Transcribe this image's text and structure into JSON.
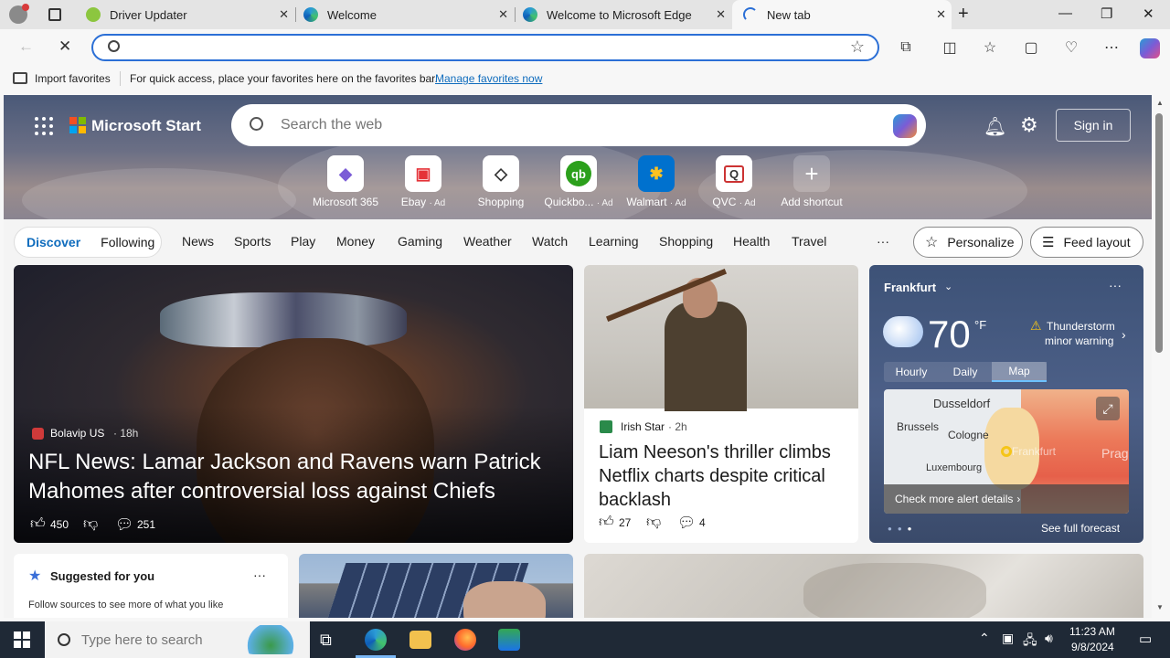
{
  "tabs": [
    {
      "title": "Driver Updater",
      "active": false
    },
    {
      "title": "Welcome",
      "active": false
    },
    {
      "title": "Welcome to Microsoft Edge",
      "active": false
    },
    {
      "title": "New tab",
      "active": true
    }
  ],
  "address": {
    "value": "",
    "placeholder": ""
  },
  "favbar": {
    "import_label": "Import favorites",
    "hint": "For quick access, place your favorites here on the favorites bar.",
    "manage_link": "Manage favorites now"
  },
  "header": {
    "brand": "Microsoft Start",
    "search_placeholder": "Search the web",
    "signin": "Sign in"
  },
  "shortcuts": [
    {
      "label": "Microsoft 365",
      "ad": "",
      "icon": "m365-icon",
      "glyph": "◆",
      "color": "#7b5cd6"
    },
    {
      "label": "Ebay",
      "ad": "· Ad",
      "icon": "ebay-icon",
      "glyph": "▣",
      "color": "#e53238"
    },
    {
      "label": "Shopping",
      "ad": "",
      "icon": "tag-icon",
      "glyph": "◇",
      "color": "#333333"
    },
    {
      "label": "Quickbo...",
      "ad": "· Ad",
      "icon": "quickbooks-icon",
      "glyph": "qb",
      "color": "#2ca01c"
    },
    {
      "label": "Walmart",
      "ad": "· Ad",
      "icon": "walmart-icon",
      "glyph": "✱",
      "color": "#0071ce"
    },
    {
      "label": "QVC",
      "ad": "· Ad",
      "icon": "qvc-icon",
      "glyph": "Q",
      "color": "#333333"
    },
    {
      "label": "Add shortcut",
      "ad": "",
      "icon": "plus-icon",
      "glyph": "+",
      "color": "#ffffff"
    }
  ],
  "feed_tabs": {
    "discover": "Discover",
    "following": "Following"
  },
  "nav": [
    "News",
    "Sports",
    "Play",
    "Money",
    "Gaming",
    "Weather",
    "Watch",
    "Learning",
    "Shopping",
    "Health",
    "Travel"
  ],
  "more": "···",
  "personalize": "Personalize",
  "feed_layout": "Feed layout",
  "big_story": {
    "source": "Bolavip US",
    "age": "· 18h",
    "headline": "NFL News: Lamar Jackson and Ravens warn Patrick Mahomes after controversial loss against Chiefs",
    "likes": "450",
    "comments": "251"
  },
  "mid_story": {
    "source": "Irish Star",
    "age": "· 2h",
    "headline": "Liam Neeson's thriller climbs Netflix charts despite critical backlash",
    "likes": "27",
    "comments": "4"
  },
  "weather": {
    "city": "Frankfurt",
    "temp": "70",
    "unit": "°F",
    "alert_line1": "Thunderstorm",
    "alert_line2": "minor warning",
    "tabs": [
      "Hourly",
      "Daily",
      "Map"
    ],
    "active_tab": "Map",
    "map_cities": [
      "Dusseldorf",
      "Brussels",
      "Cologne",
      "Luxembourg",
      "Frankfurt",
      "Prag"
    ],
    "alert_link": "Check more alert details",
    "forecast_link": "See full forecast"
  },
  "suggest": {
    "title": "Suggested for you",
    "body": "Follow sources to see more of what you like"
  },
  "taskbar": {
    "search_placeholder": "Type here to search",
    "time": "11:23 AM",
    "date": "9/8/2024"
  },
  "colors": {
    "accent": "#0f6cbd",
    "edge_blue": "#2b6fd6"
  }
}
